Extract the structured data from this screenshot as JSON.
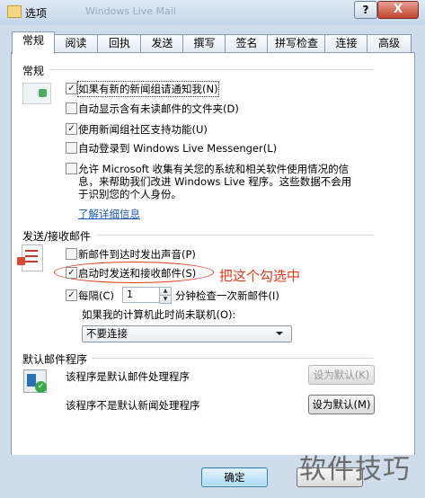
{
  "window": {
    "title": "选项",
    "ghost_title": "Windows Live Mail",
    "help_label": "?",
    "close_label": "X"
  },
  "tabs": [
    "常规",
    "阅读",
    "回执",
    "发送",
    "撰写",
    "签名",
    "拼写检查",
    "连接",
    "高级"
  ],
  "general_section": {
    "title": "常规",
    "options": [
      {
        "label": "如果有新的新闻组请通知我(N)",
        "checked": true
      },
      {
        "label": "自动显示含有未读邮件的文件夹(D)",
        "checked": false
      },
      {
        "label": "使用新闻组社区支持功能(U)",
        "checked": true
      },
      {
        "label": "自动登录到 Windows Live Messenger(L)",
        "checked": false
      },
      {
        "label_lines": [
          "允许 Microsoft 收集有关您的系统和相关软件使用情况的信",
          "息，来帮助我们改进 Windows Live 程序。这些数据不会用",
          "于识别您的个人身份。"
        ],
        "checked": false
      }
    ],
    "link": "了解详细信息"
  },
  "send_receive_section": {
    "title": "发送/接收邮件",
    "sound_option": {
      "label": "新邮件到达时发出声音(P)",
      "checked": false
    },
    "startup_option": {
      "label": "启动时发送和接收邮件(S)",
      "checked": true
    },
    "annotation": "把这个勾选中",
    "interval": {
      "prefix": "每隔(C)",
      "value": "1",
      "suffix": "分钟检查一次新邮件(I)",
      "checked": true
    },
    "offline_label": "如果我的计算机此时尚未联机(O):",
    "offline_select": "不要连接"
  },
  "default_section": {
    "title": "默认邮件程序",
    "mail_text": "该程序是默认邮件处理程序",
    "mail_button": "设为默认(K)",
    "news_text": "该程序不是默认新闻处理程序",
    "news_button": "设为默认(M)"
  },
  "footer": {
    "ok_label": "确定"
  },
  "watermark": "软件技巧"
}
